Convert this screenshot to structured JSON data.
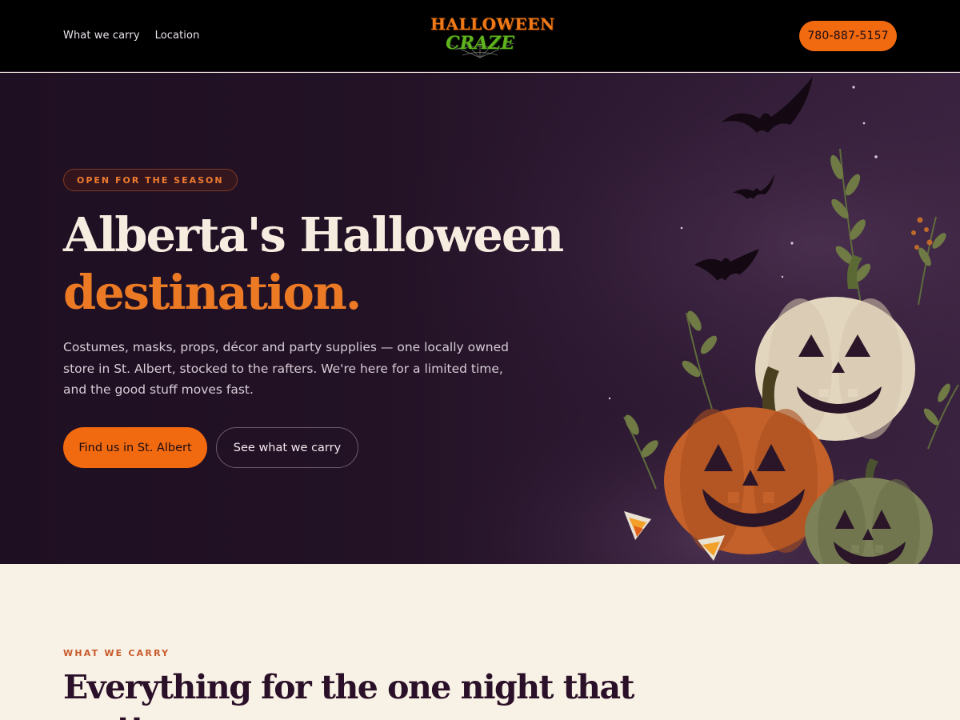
{
  "header": {
    "nav": [
      "What we carry",
      "Location"
    ],
    "logo": {
      "line1": "HALLOWEEN",
      "line2": "CRAZE"
    },
    "phone": "780-887-5157"
  },
  "hero": {
    "badge": "OPEN FOR THE SEASON",
    "title_line1": "Alberta's Halloween",
    "title_line2": "destination.",
    "lead": "Costumes, masks, props, décor and party supplies — one locally owned store in St. Albert, stocked to the rafters. We're here for a limited time, and the good stuff moves fast.",
    "primary_cta": "Find us in St. Albert",
    "secondary_cta": "See what we carry"
  },
  "section": {
    "eyebrow": "WHAT WE CARRY",
    "title": "Everything for the one night that matters."
  },
  "colors": {
    "accent": "#f26a10",
    "hero_bg": "#231226",
    "cream": "#f8f1e5",
    "heading_dark": "#2a1028"
  },
  "icons": [
    "halloween-craze-logo",
    "bat-icon",
    "pumpkin-icon",
    "leaf-icon",
    "candy-corn-icon",
    "star-icon"
  ]
}
